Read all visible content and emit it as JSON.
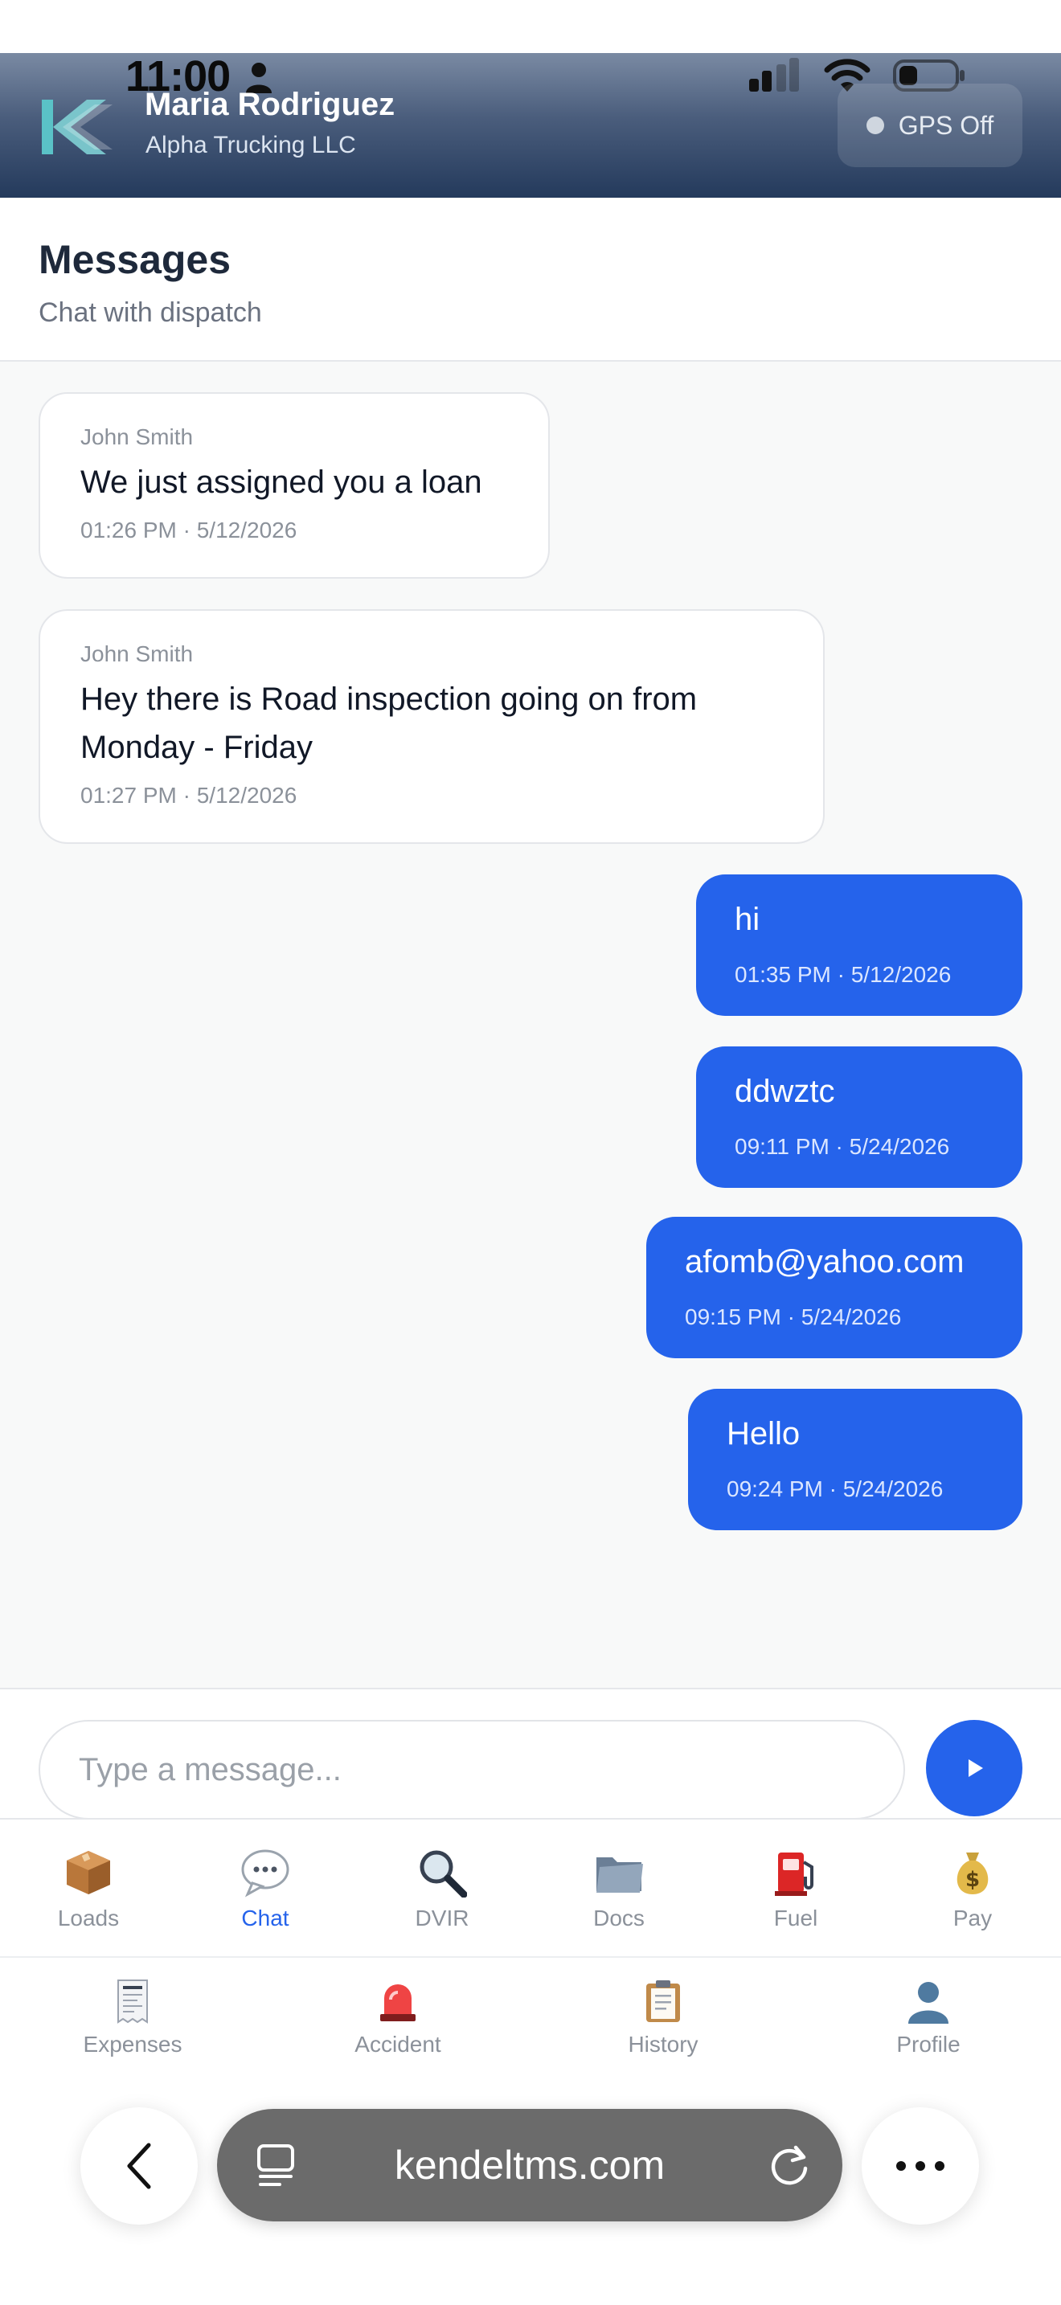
{
  "status_bar": {
    "time": "11:00"
  },
  "header": {
    "driver_name": "Maria Rodriguez",
    "company": "Alpha Trucking LLC",
    "gps_label": "GPS Off"
  },
  "page": {
    "title": "Messages",
    "subtitle": "Chat with dispatch"
  },
  "messages": [
    {
      "direction": "in",
      "sender": "John Smith",
      "text": "We just assigned you a loan",
      "time": "01:26 PM · 5/12/2026"
    },
    {
      "direction": "in",
      "sender": "John Smith",
      "text": "Hey there is Road inspection going on from Monday - Friday",
      "time": "01:27 PM · 5/12/2026"
    },
    {
      "direction": "out",
      "text": "hi",
      "time": "01:35 PM · 5/12/2026"
    },
    {
      "direction": "out",
      "text": "ddwztc",
      "time": "09:11 PM · 5/24/2026"
    },
    {
      "direction": "out",
      "text": "afomb@yahoo.com",
      "time": "09:15 PM · 5/24/2026"
    },
    {
      "direction": "out",
      "text": "Hello",
      "time": "09:24 PM · 5/24/2026"
    }
  ],
  "composer": {
    "placeholder": "Type a message..."
  },
  "nav_primary": [
    {
      "label": "Loads",
      "icon": "package-icon"
    },
    {
      "label": "Chat",
      "icon": "chat-icon",
      "active": true
    },
    {
      "label": "DVIR",
      "icon": "magnifier-icon"
    },
    {
      "label": "Docs",
      "icon": "folder-icon"
    },
    {
      "label": "Fuel",
      "icon": "fuel-pump-icon"
    },
    {
      "label": "Pay",
      "icon": "money-bag-icon"
    }
  ],
  "nav_secondary": [
    {
      "label": "Expenses",
      "icon": "receipt-icon"
    },
    {
      "label": "Accident",
      "icon": "siren-icon"
    },
    {
      "label": "History",
      "icon": "clipboard-icon"
    },
    {
      "label": "Profile",
      "icon": "profile-icon"
    }
  ],
  "browser": {
    "url": "kendeltms.com"
  },
  "colors": {
    "accent": "#2563eb",
    "header_dark": "#243a5c"
  }
}
